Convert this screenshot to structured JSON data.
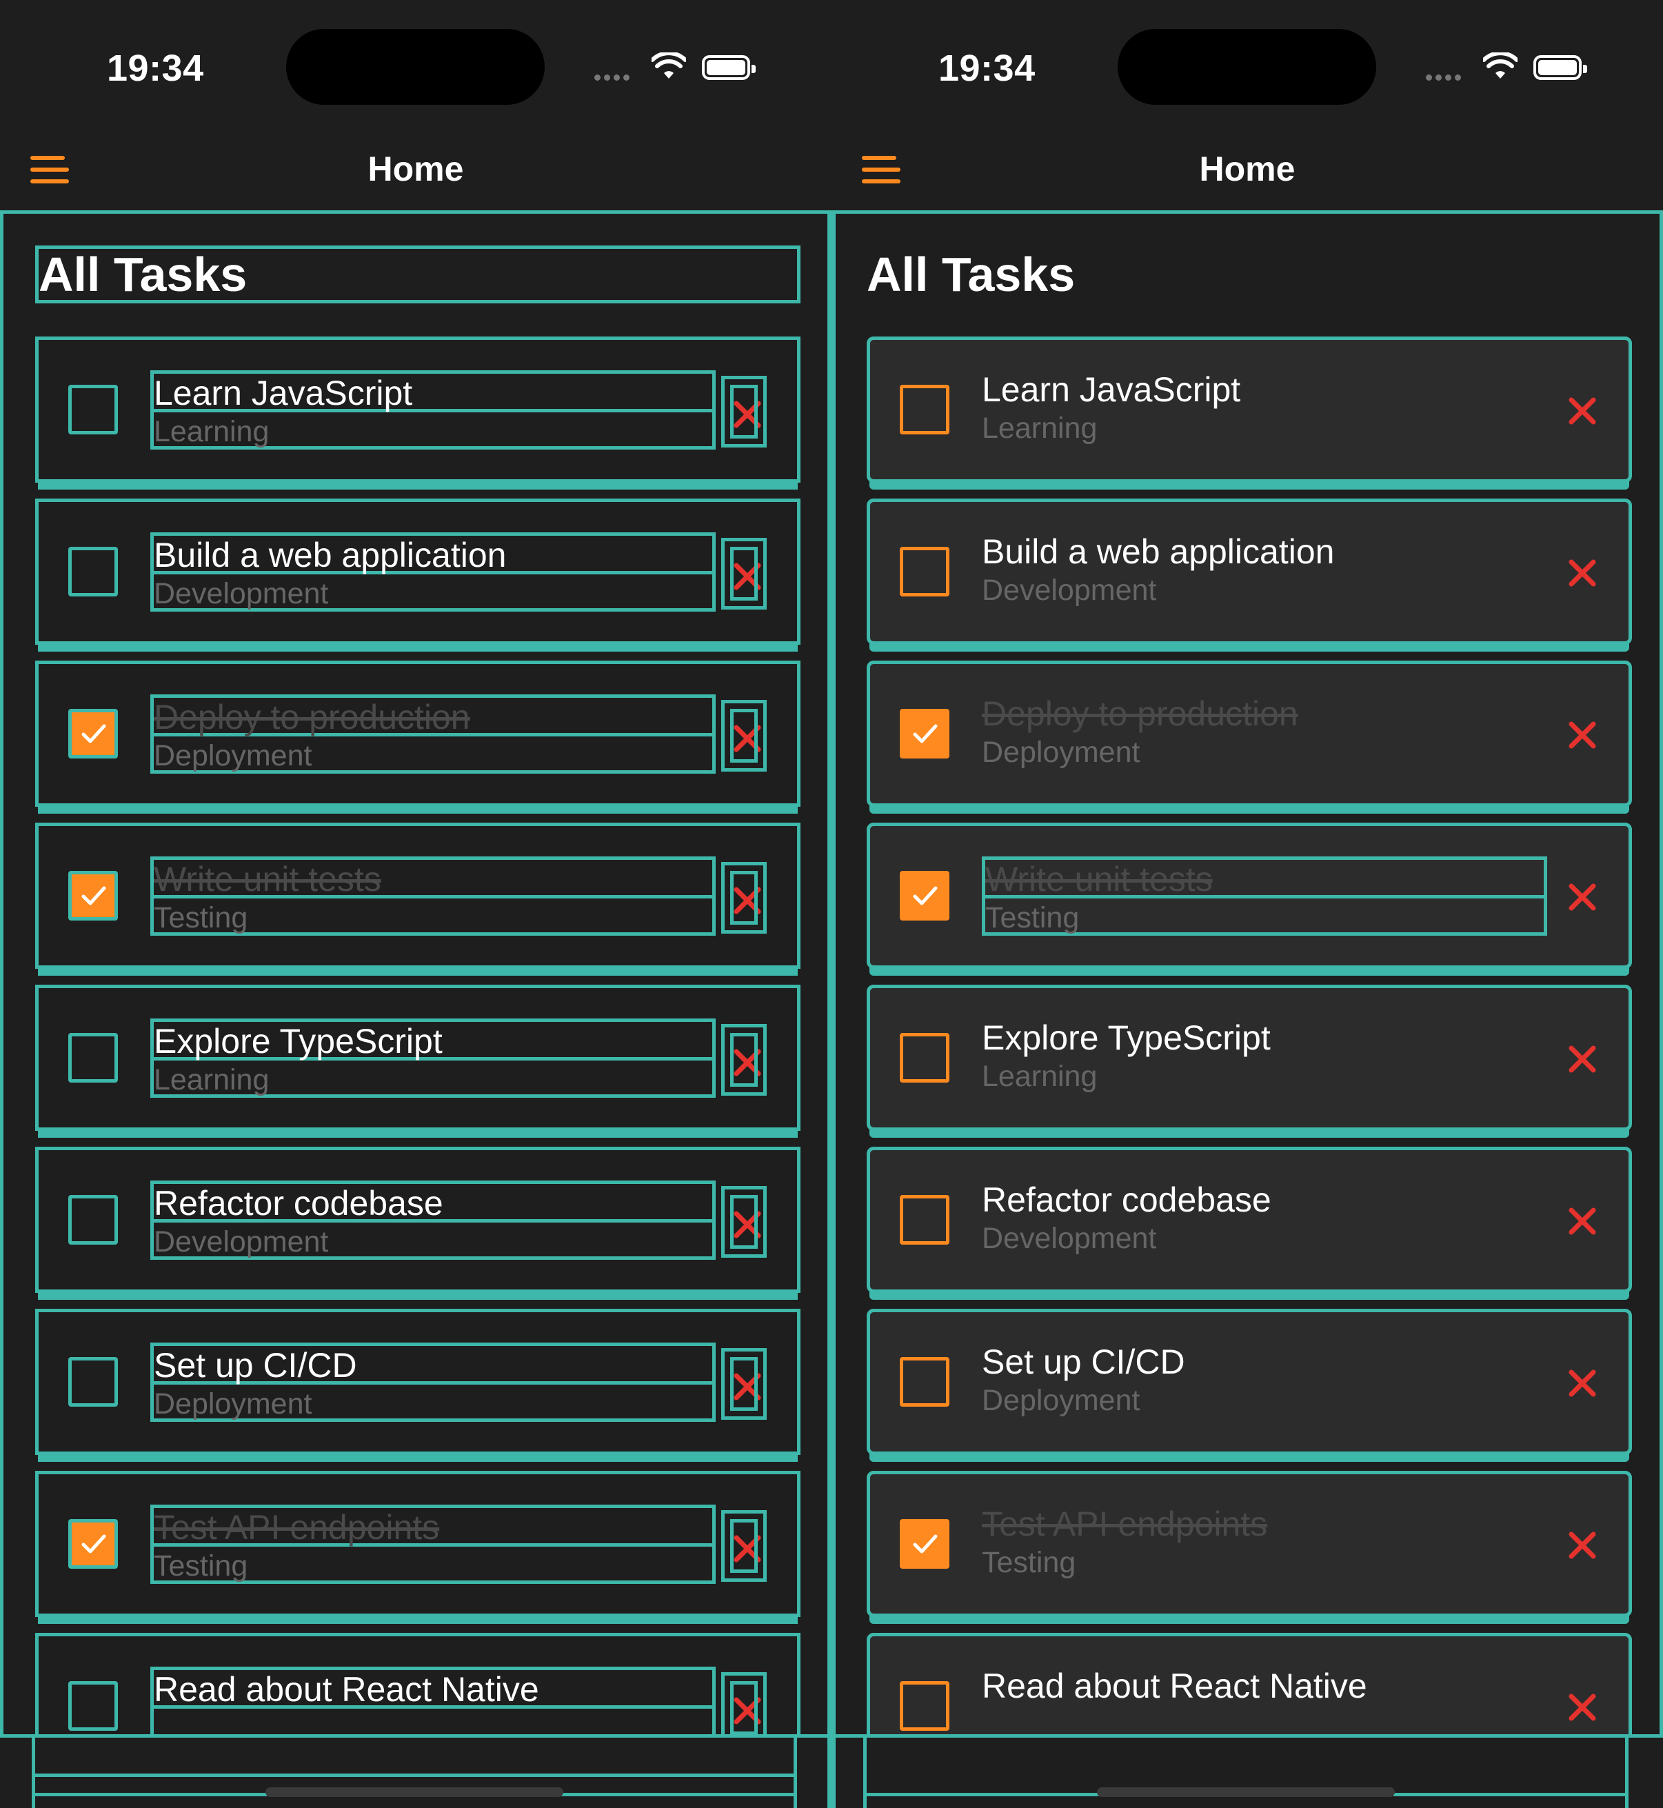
{
  "status_bar": {
    "time": "19:34"
  },
  "nav": {
    "title": "Home"
  },
  "section": {
    "title": "All Tasks"
  },
  "tasks": [
    {
      "title": "Learn JavaScript",
      "category": "Learning",
      "completed": false
    },
    {
      "title": "Build a web application",
      "category": "Development",
      "completed": false
    },
    {
      "title": "Deploy to production",
      "category": "Deployment",
      "completed": true
    },
    {
      "title": "Write unit tests",
      "category": "Testing",
      "completed": true
    },
    {
      "title": "Explore TypeScript",
      "category": "Learning",
      "completed": false
    },
    {
      "title": "Refactor codebase",
      "category": "Development",
      "completed": false
    },
    {
      "title": "Set up CI/CD",
      "category": "Deployment",
      "completed": false
    },
    {
      "title": "Test API endpoints",
      "category": "Testing",
      "completed": true
    },
    {
      "title": "Read about React Native",
      "category": "",
      "completed": false
    }
  ],
  "colors": {
    "accent": "#ff8a1f",
    "delete": "#e5322d",
    "outline": "#3eb8aa",
    "background": "#1e1e1e",
    "card": "#2c2c2d"
  },
  "icons": {
    "menu": "hamburger-menu-icon",
    "check": "checkmark-icon",
    "delete": "close-x-icon",
    "wifi": "wifi-icon",
    "battery": "battery-icon"
  }
}
